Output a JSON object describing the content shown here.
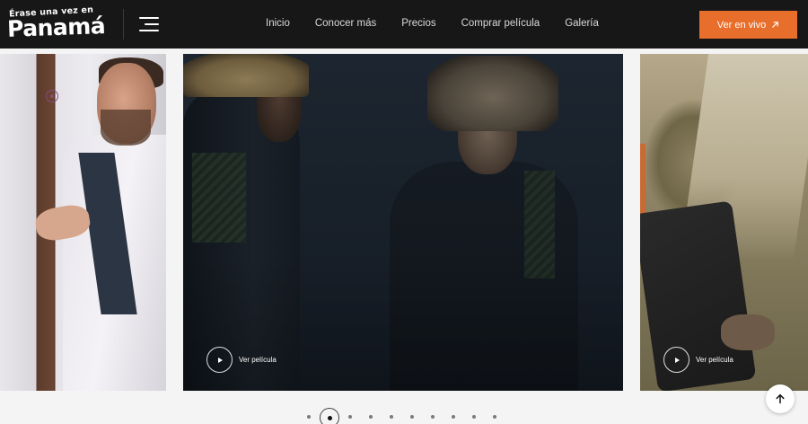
{
  "brand": {
    "logo_top": "Érase una vez en",
    "logo_main": "Panamá"
  },
  "nav": {
    "items": [
      "Inicio",
      "Conocer más",
      "Precios",
      "Comprar película",
      "Galería"
    ]
  },
  "cta": {
    "label": "Ver en vivo",
    "icon": "arrow-up-right-icon",
    "color": "#e86e2b"
  },
  "slides": {
    "center_label": "Ver película",
    "right_label": "Ver película",
    "icon": "play-icon"
  },
  "carousel": {
    "total_dots": 10,
    "active_index": 1
  },
  "colors": {
    "header_bg": "#171717",
    "accent": "#e86e2b"
  },
  "scroll_top_icon": "arrow-up-icon"
}
